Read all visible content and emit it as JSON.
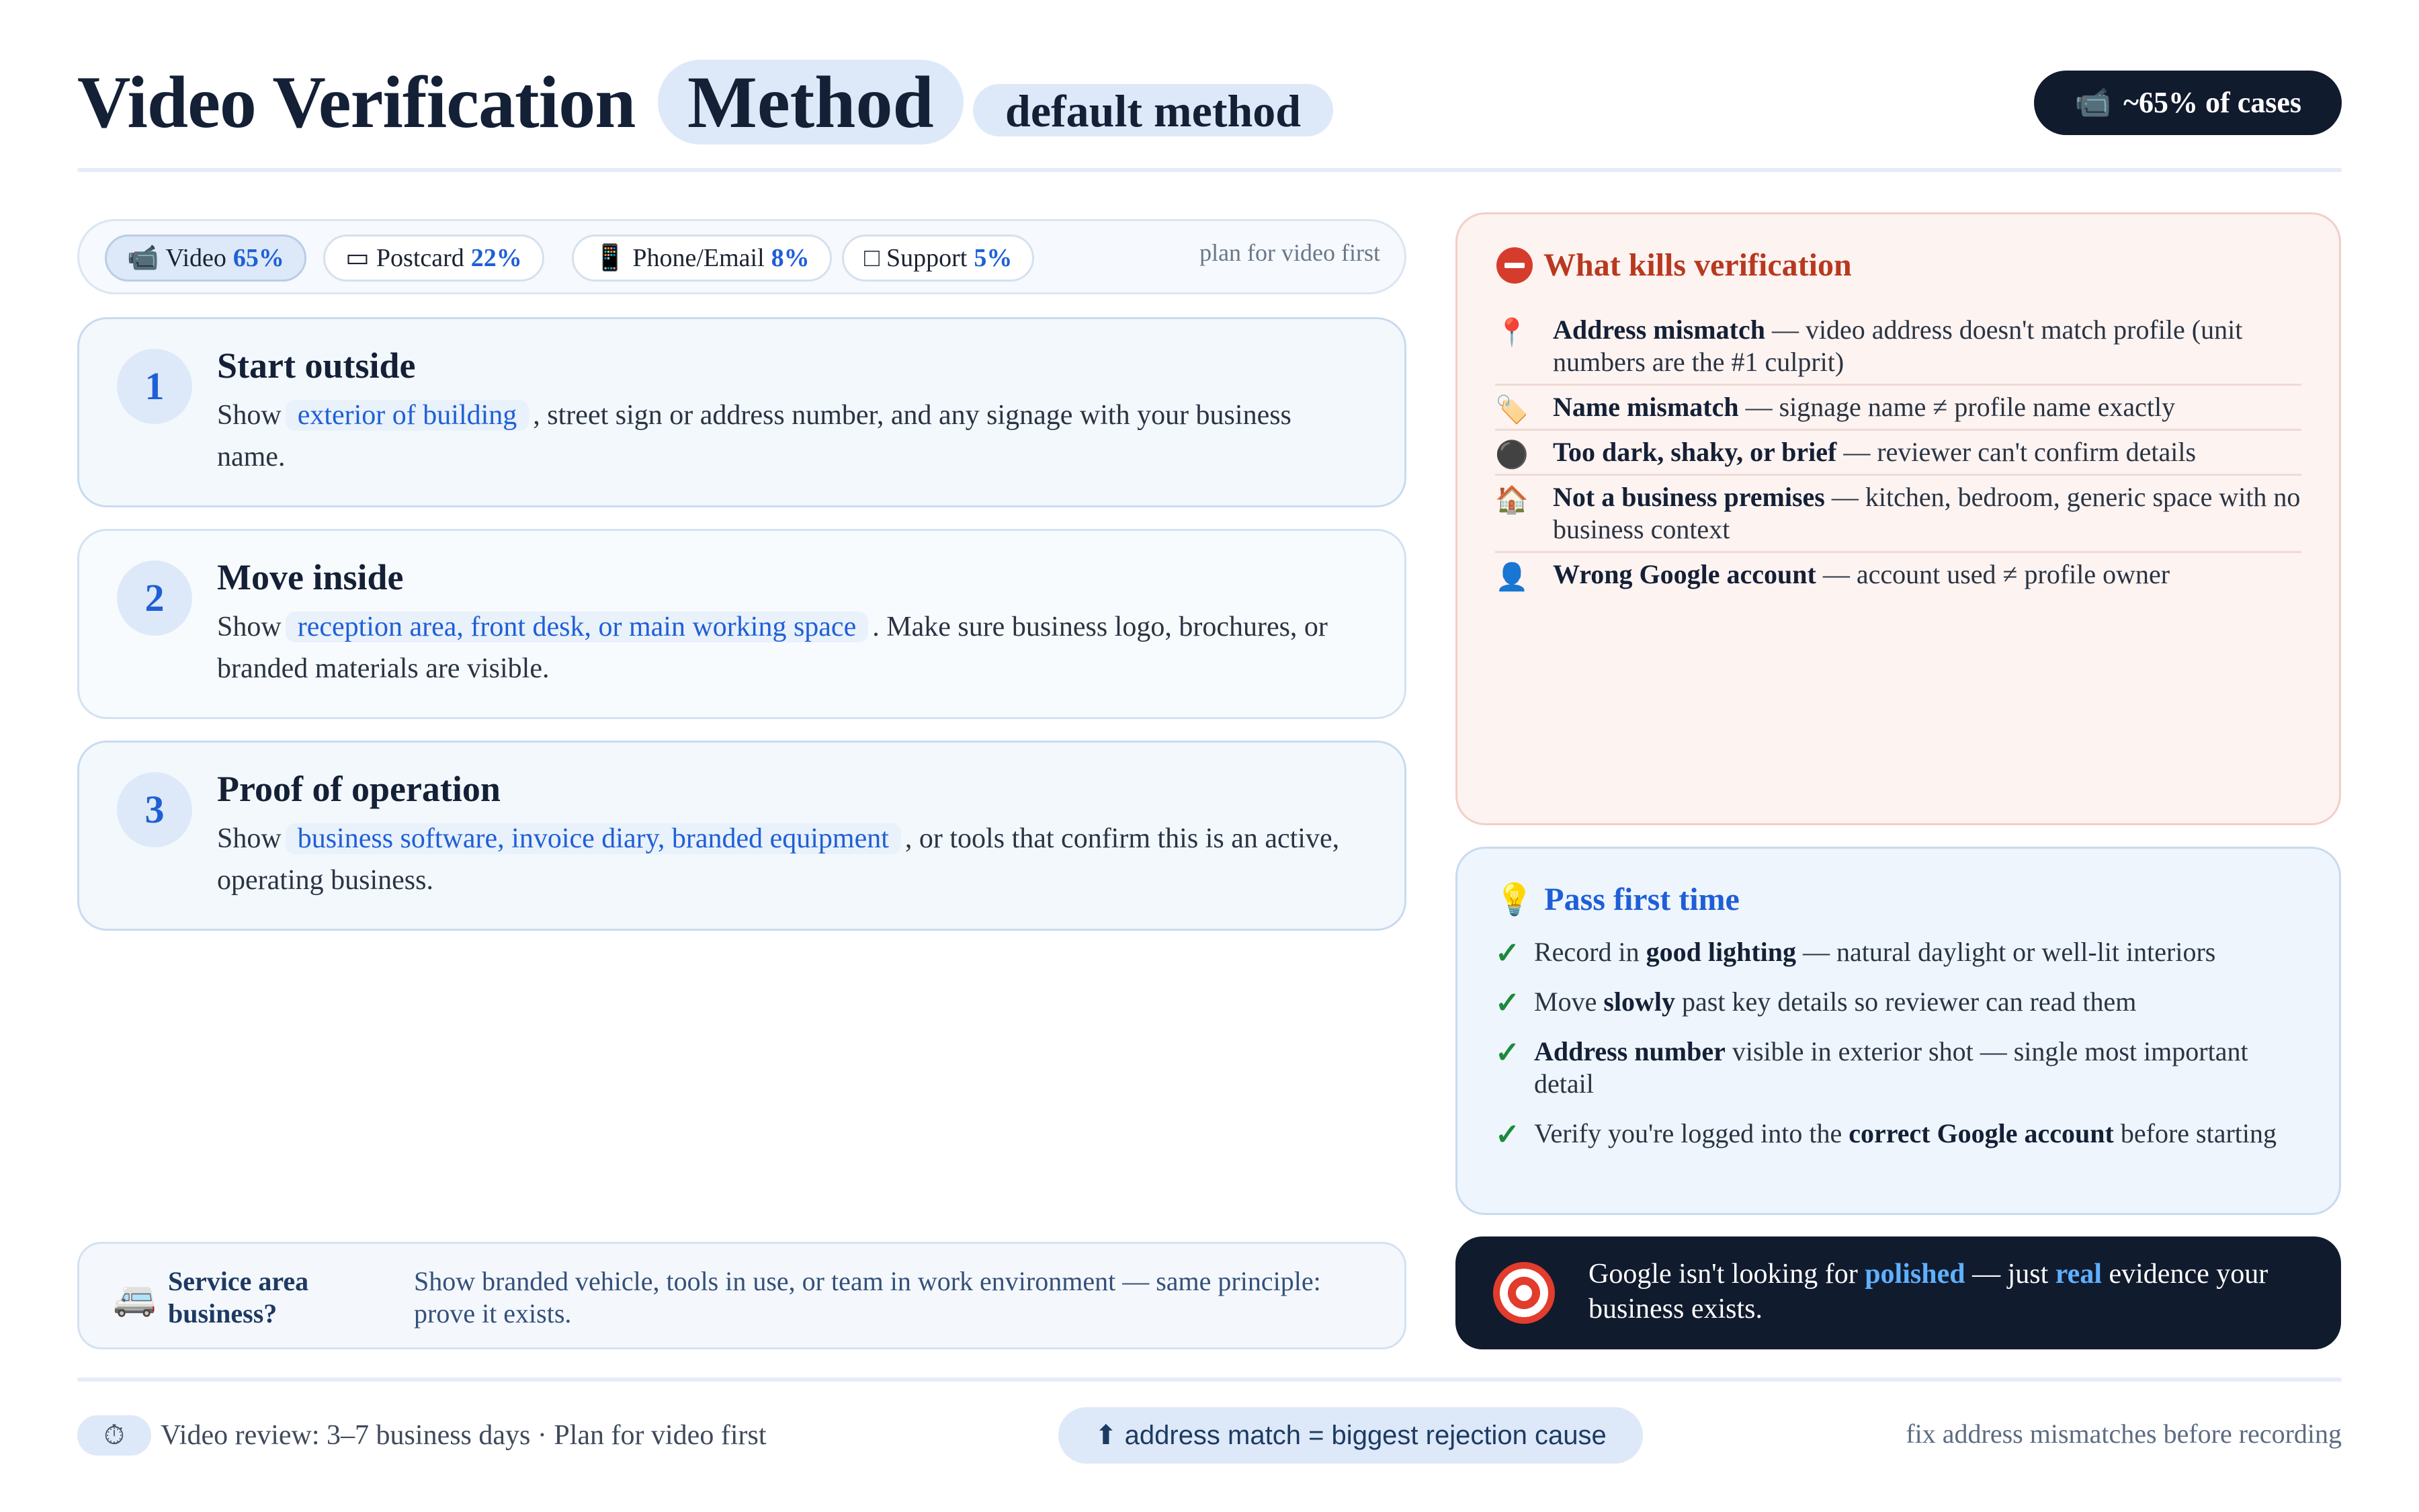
{
  "header": {
    "title": "Video Verification",
    "title_pill": "Method",
    "sub_pill": "default method",
    "cases_icon": "video-camera-icon",
    "cases_glyph": "📹",
    "cases_label": "~65% of cases"
  },
  "tabs": {
    "items": [
      {
        "glyph": "📹",
        "icon": "video-icon",
        "label": "Video",
        "pct": "65%",
        "active": true
      },
      {
        "glyph": "▭",
        "icon": "postcard-icon",
        "label": "Postcard",
        "pct": "22%",
        "active": false
      },
      {
        "glyph": "📱",
        "icon": "phone-icon",
        "label": "Phone/Email",
        "pct": "8%",
        "active": false
      },
      {
        "glyph": "□",
        "icon": "support-icon",
        "label": "Support",
        "pct": "5%",
        "active": false
      }
    ],
    "hint": "plan for video first"
  },
  "steps": [
    {
      "num": "1",
      "title": "Start outside",
      "pre": "Show",
      "highlight": "exterior of building",
      "post": ", street sign or address number, and any signage with your business name."
    },
    {
      "num": "2",
      "title": "Move inside",
      "pre": "Show",
      "highlight": "reception area, front desk, or main working space",
      "post": ". Make sure business logo, brochures, or branded materials are visible."
    },
    {
      "num": "3",
      "title": "Proof of operation",
      "pre": "Show",
      "highlight": "business software, invoice diary, branded equipment",
      "post": ", or tools that confirm this is an active, operating business."
    }
  ],
  "service": {
    "glyph": "🚐",
    "icon": "van-icon",
    "title": "Service area business?",
    "text": "Show branded vehicle, tools in use, or team in work environment — same principle: prove it exists."
  },
  "kills": {
    "title": "What kills verification",
    "icon": "no-entry-icon",
    "items": [
      {
        "glyph": "📍",
        "icon": "pin-icon",
        "bold": "Address mismatch",
        "text": " — video address doesn't match profile (unit numbers are the #1 culprit)"
      },
      {
        "glyph": "🏷️",
        "icon": "tag-icon",
        "bold": "Name mismatch",
        "text": " — signage name ≠ profile name exactly"
      },
      {
        "glyph": "⚫",
        "icon": "dark-circle-icon",
        "bold": "Too dark, shaky, or brief",
        "text": " — reviewer can't confirm details"
      },
      {
        "glyph": "🏠",
        "icon": "house-icon",
        "bold": "Not a business premises",
        "text": " — kitchen, bedroom, generic space with no business context"
      },
      {
        "glyph": "👤",
        "icon": "user-icon",
        "bold": "Wrong Google account",
        "text": " — account used ≠ profile owner"
      }
    ]
  },
  "pass": {
    "title": "Pass first time",
    "icon": "lightbulb-icon",
    "glyph": "💡",
    "check_glyph": "✓",
    "items": [
      {
        "pre": "Record in ",
        "bold": "good lighting",
        "post": " — natural daylight or well-lit interiors"
      },
      {
        "pre": "Move ",
        "bold": "slowly",
        "post": " past key details so reviewer can read them"
      },
      {
        "pre": "",
        "bold": "Address number",
        "post": " visible in exterior shot — single most important detail"
      },
      {
        "pre": "Verify you're logged into the ",
        "bold": "correct Google account",
        "post": " before starting"
      }
    ]
  },
  "quote": {
    "icon": "target-icon",
    "part1": "Google isn't looking for ",
    "em1": "polished",
    "part2": " — just ",
    "em2": "real",
    "part3": " evidence your business exists."
  },
  "footer": {
    "clock_glyph": "⏱",
    "left": "Video review: 3–7 business days · Plan for video first",
    "middle": "⬆ address match = biggest rejection cause",
    "right": "fix address mismatches before recording"
  }
}
